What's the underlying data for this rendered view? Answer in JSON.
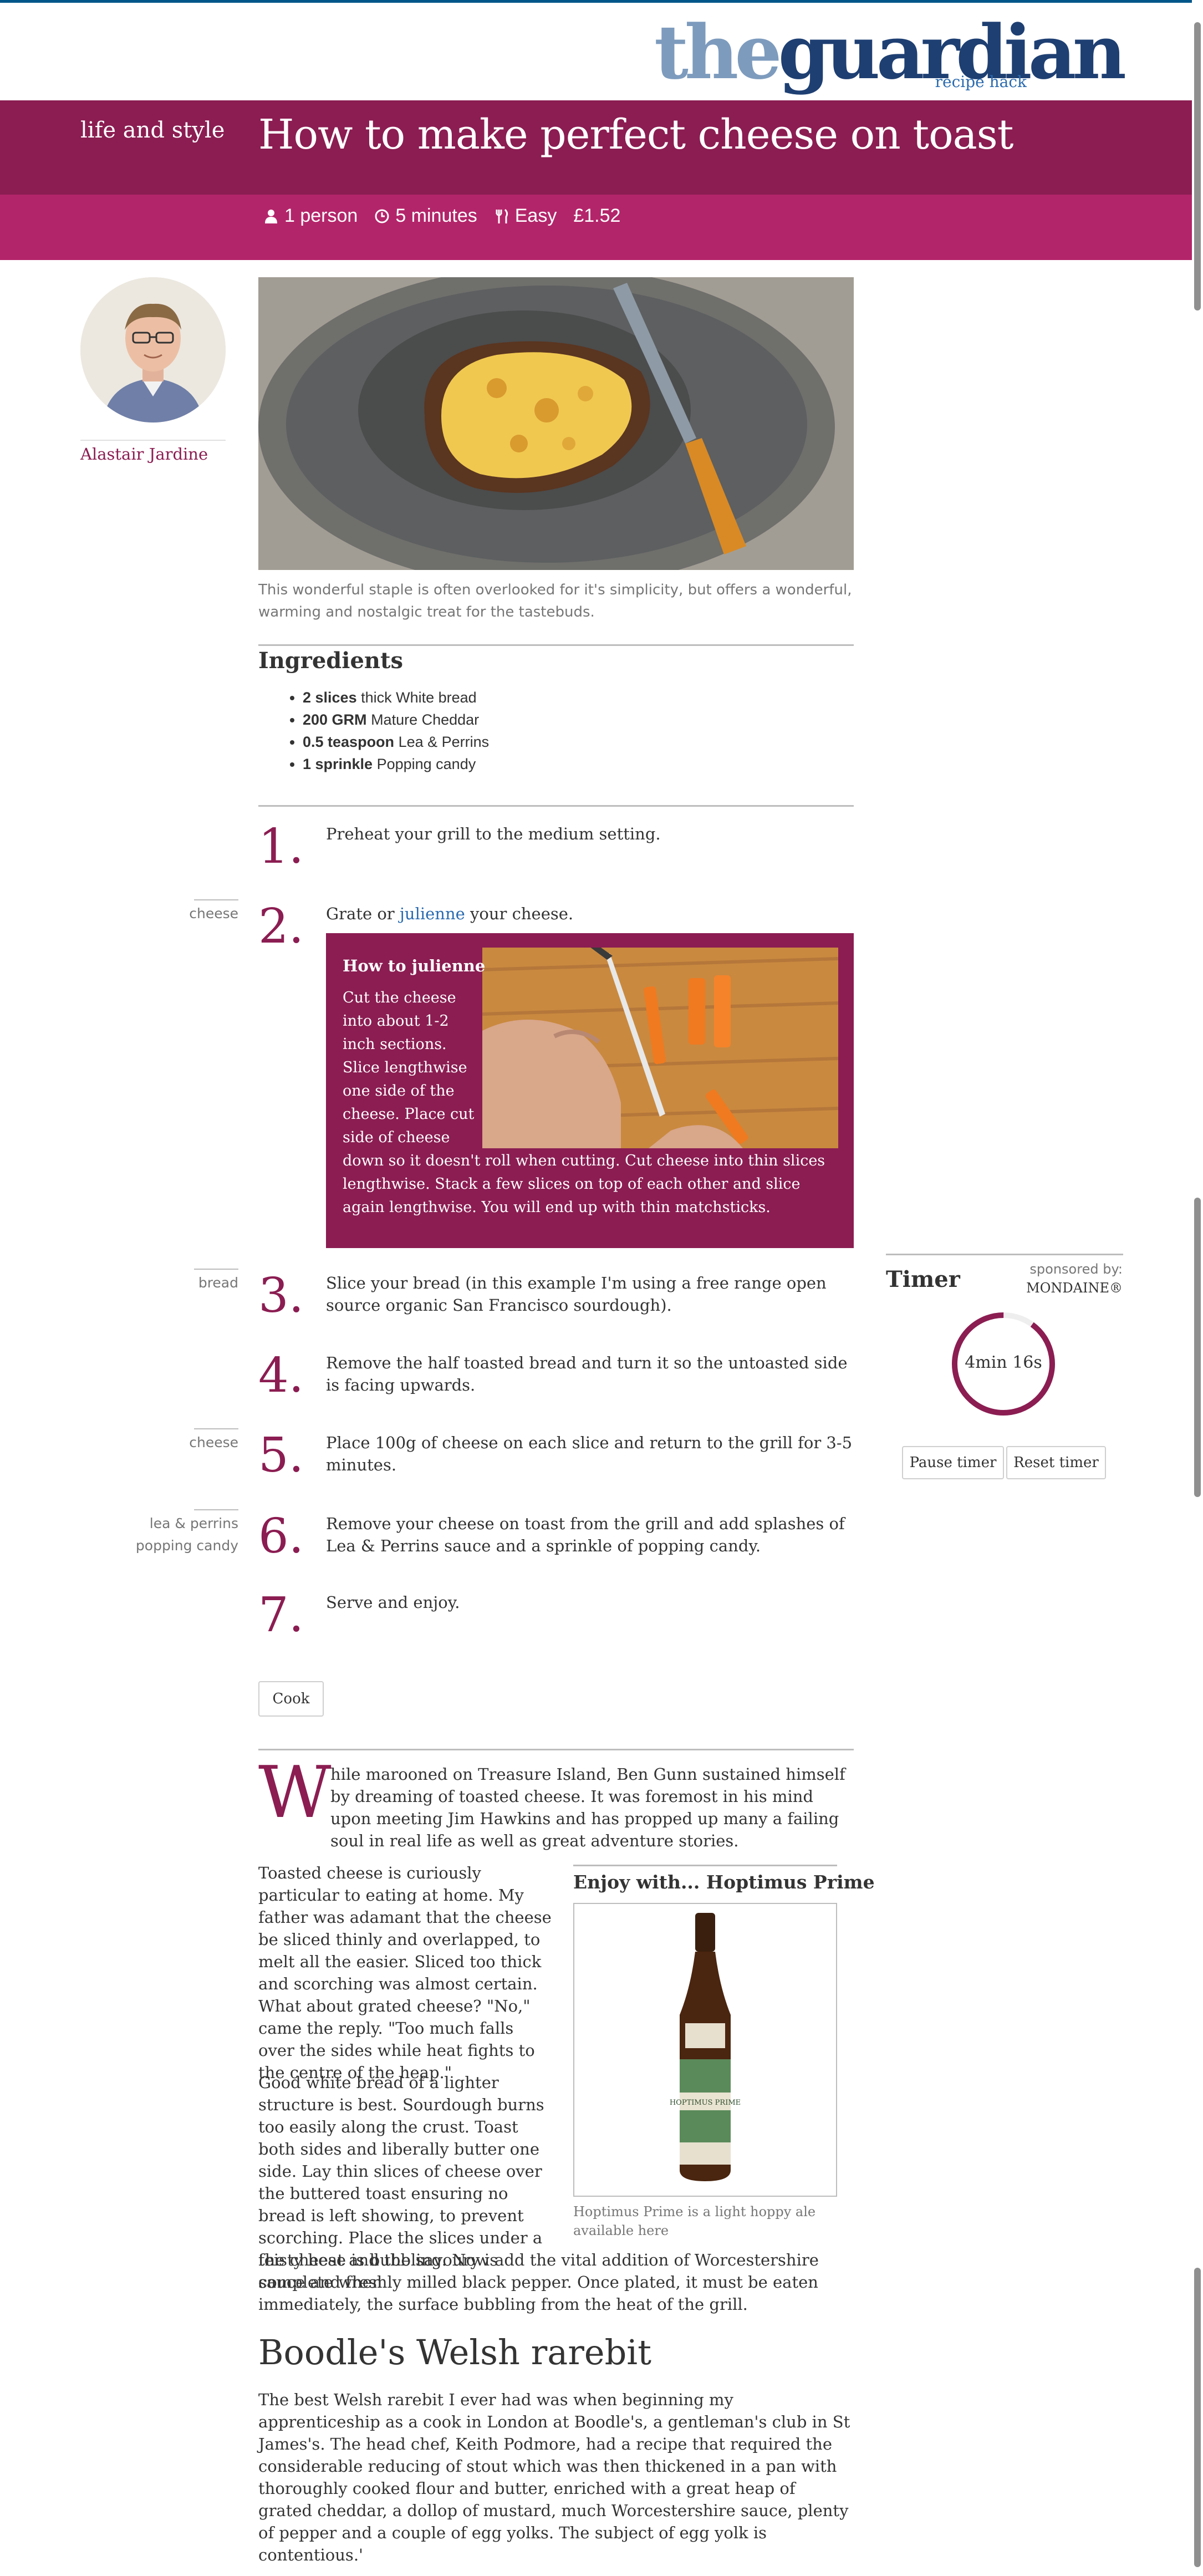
{
  "masthead": {
    "logo_the": "the",
    "logo_guardian": "guardian",
    "logo_sub": "recipe hack"
  },
  "header": {
    "section": "life and style",
    "title": "How to make perfect cheese on toast",
    "servings": "1 person",
    "time": "5 minutes",
    "difficulty": "Easy",
    "cost": "£1.52"
  },
  "author": {
    "name": "Alastair Jardine"
  },
  "hero": {
    "caption": "This wonderful staple is often overlooked for it's simplicity, but offers a wonderful, warming and nostalgic treat for the tastebuds."
  },
  "ingredients": {
    "title": "Ingredients",
    "items": [
      {
        "qty": "2 slices",
        "name": "thick White bread"
      },
      {
        "qty": "200 GRM",
        "name": "Mature Cheddar"
      },
      {
        "qty": "0.5 teaspoon",
        "name": "Lea & Perrins"
      },
      {
        "qty": "1 sprinkle",
        "name": "Popping candy"
      }
    ]
  },
  "steps": [
    {
      "num": "1.",
      "text": "Preheat your grill to the medium setting.",
      "tag": ""
    },
    {
      "num": "2.",
      "text_before": "Grate or ",
      "link": "julienne",
      "text_after": " your cheese.",
      "tag": "cheese"
    },
    {
      "num": "3.",
      "text": "Slice your bread (in this example I'm using a free range open source organic San Francisco sourdough).",
      "tag": "bread"
    },
    {
      "num": "4.",
      "text": "Remove the half toasted bread and turn it so the untoasted side is facing upwards.",
      "tag": ""
    },
    {
      "num": "5.",
      "text": "Place 100g of cheese on each slice and return to the grill for 3-5 minutes.",
      "tag": "cheese"
    },
    {
      "num": "6.",
      "text": "Remove your cheese on toast from the grill and add splashes of Lea & Perrins sauce and a sprinkle of popping candy.",
      "tag_line1": "lea & perrins",
      "tag_line2": "popping candy"
    },
    {
      "num": "7.",
      "text": "Serve and enjoy.",
      "tag": ""
    }
  ],
  "julienne": {
    "title": "How to julienne",
    "text": "Cut the cheese into about 1-2 inch sections. Slice lengthwise one side of the cheese. Place cut side of cheese down so it doesn't roll when cutting. Cut cheese into thin slices lengthwise. Stack a few slices on top of each other and slice again lengthwise. You will end up with thin matchsticks."
  },
  "timer": {
    "title": "Timer",
    "sponsored_label": "sponsored by:",
    "sponsor": "MONDAINE®",
    "value": "4min 16s",
    "progress": 0.9,
    "pause_label": "Pause timer",
    "reset_label": "Reset timer"
  },
  "cook_button": "Cook",
  "article": {
    "dropcap": "W",
    "intro": "hile marooned on Treasure Island, Ben Gunn sustained himself by dreaming of toasted cheese. It was foremost in his mind upon meeting Jim Hawkins and has propped up many a failing soul in real life as well as great adventure stories.",
    "p2": "Toasted cheese is curiously particular to eating at home. My father was adamant that the cheese be sliced thinly and overlapped, to melt all the easier. Sliced too thick and scorching was almost certain. What about grated cheese? \"No,\" came the reply. \"Too much falls over the sides while heat fights to the centre of the heap.\"",
    "p3a": "Good white bread of a lighter structure is best. Sourdough burns too easily along the crust. Toast both sides and liberally butter one side. Lay thin slices of cheese over the buttered toast ensuring no bread is left showing, to prevent scorching. Place the slices under a feisty heat and the savoury is complete when",
    "p3b": "the cheese is bubbling. Now add the vital addition of Worcestershire sauce and freshly milled black pepper. Once plated, it must be eaten immediately, the surface bubbling from the heat of the grill.",
    "aside_title": "Enjoy with... Hoptimus Prime",
    "aside_caption": "Hoptimus Prime is a light hoppy ale available here",
    "bottle_label": "HOPTIMUS PRIME",
    "h2": "Boodle's Welsh rarebit",
    "p4": "The best Welsh rarebit I ever had was when beginning my apprenticeship as a cook in London at Boodle's, a gentleman's club in St James's. The head chef, Keith Podmore, had a recipe that required the considerable reducing of stout which was then thickened in a pan with thoroughly cooked flour and butter, enriched with a great heap of grated cheddar, a dollop of mustard, much Worcestershire sauce, plenty of pepper and a couple of egg yolks. The subject of egg yolk is contentious.'"
  },
  "colors": {
    "brand_dark": "#8b1d52",
    "brand_light": "#b3256a",
    "link": "#2a6bb0"
  }
}
